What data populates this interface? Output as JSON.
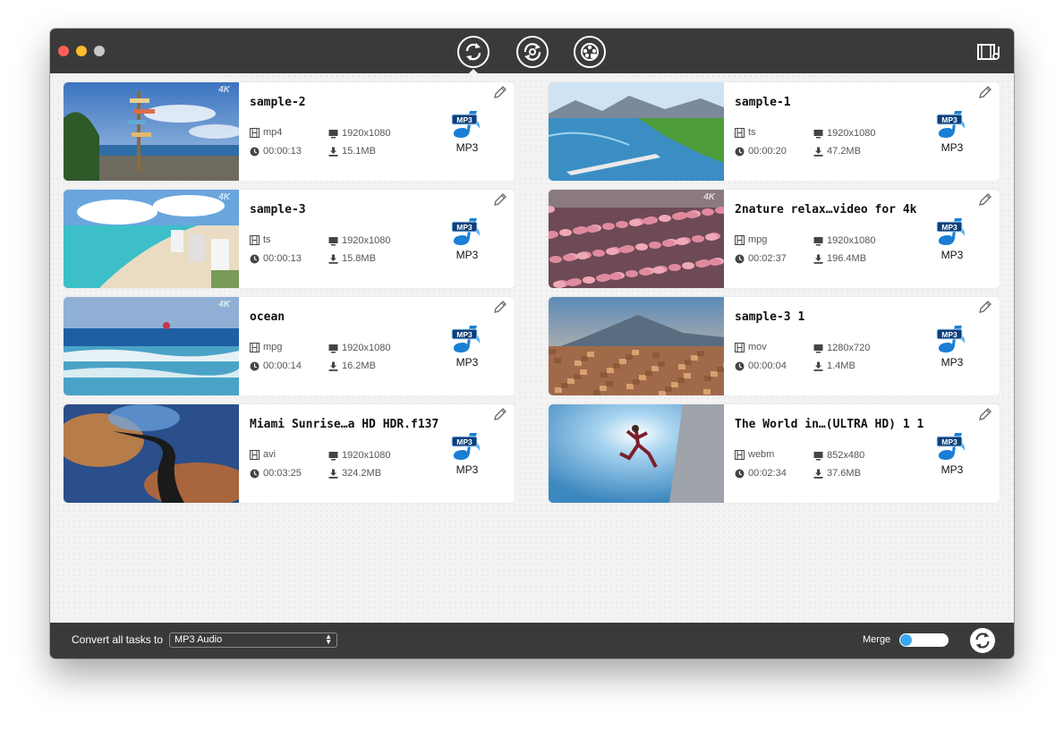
{
  "toolbar": {
    "buttons": [
      {
        "icon": "convert-icon",
        "active": true
      },
      {
        "icon": "rotate-icon",
        "active": false
      },
      {
        "icon": "film-icon",
        "active": false
      }
    ],
    "right_icon": "media-library-icon"
  },
  "tasks": [
    {
      "title": "sample-2",
      "format": "mp4",
      "resolution": "1920x1080",
      "duration": "00:00:13",
      "size": "15.1MB",
      "output": "MP3",
      "thumb": "beach-signpost"
    },
    {
      "title": "sample-1",
      "format": "ts",
      "resolution": "1920x1080",
      "duration": "00:00:20",
      "size": "47.2MB",
      "output": "MP3",
      "thumb": "lake-mountains"
    },
    {
      "title": "sample-3",
      "format": "ts",
      "resolution": "1920x1080",
      "duration": "00:00:13",
      "size": "15.8MB",
      "output": "MP3",
      "thumb": "beach-hotels"
    },
    {
      "title": "2nature relax…video for 4k",
      "format": "mpg",
      "resolution": "1920x1080",
      "duration": "00:02:37",
      "size": "196.4MB",
      "output": "MP3",
      "thumb": "flamingos"
    },
    {
      "title": "ocean",
      "format": "mpg",
      "resolution": "1920x1080",
      "duration": "00:00:14",
      "size": "16.2MB",
      "output": "MP3",
      "thumb": "ocean-waves"
    },
    {
      "title": "sample-3 1",
      "format": "mov",
      "resolution": "1280x720",
      "duration": "00:00:04",
      "size": "1.4MB",
      "output": "MP3",
      "thumb": "city-volcano"
    },
    {
      "title": "Miami Sunrise…a HD HDR.f137",
      "format": "avi",
      "resolution": "1920x1080",
      "duration": "00:03:25",
      "size": "324.2MB",
      "output": "MP3",
      "thumb": "anhinga-bird"
    },
    {
      "title": "The World in…(ULTRA HD) 1 1",
      "format": "webm",
      "resolution": "852x480",
      "duration": "00:02:34",
      "size": "37.6MB",
      "output": "MP3",
      "thumb": "jumper-sky"
    }
  ],
  "badge_4k": "4K",
  "output_icon_text": "MP3",
  "bottom": {
    "convert_label": "Convert all tasks to",
    "format_value": "MP3 Audio",
    "merge_label": "Merge",
    "merge_on": false
  },
  "colors": {
    "chrome": "#3a3a3a",
    "accent": "#3aa8f0",
    "mp3_blue": "#1a7fd4"
  }
}
